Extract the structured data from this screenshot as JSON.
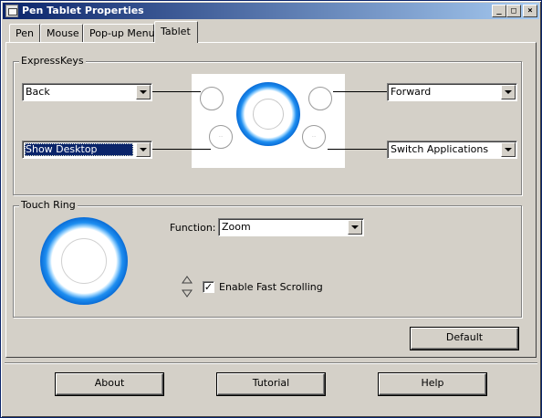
{
  "window": {
    "title": "Pen Tablet Properties",
    "controls": {
      "minimize": "_",
      "maximize": "□",
      "close": "×"
    }
  },
  "tabs": [
    {
      "label": "Pen",
      "active": false
    },
    {
      "label": "Mouse",
      "active": false
    },
    {
      "label": "Pop-up Menu",
      "active": false
    },
    {
      "label": "Tablet",
      "active": true
    }
  ],
  "expresskeys": {
    "label": "ExpressKeys",
    "top_left": {
      "value": "Back"
    },
    "bottom_left": {
      "value": "Show Desktop",
      "selected": true
    },
    "top_right": {
      "value": "Forward"
    },
    "bottom_right": {
      "value": "Switch Applications"
    },
    "key_labels": {
      "bottom_left": "···",
      "bottom_right": "···"
    }
  },
  "touch_ring": {
    "label": "Touch Ring",
    "function_label": "Function:",
    "function_value": "Zoom",
    "fast_scrolling_label": "Enable Fast Scrolling",
    "fast_scrolling_checked": true,
    "check_mark": "✓"
  },
  "buttons": {
    "default": "Default",
    "about": "About",
    "tutorial": "Tutorial",
    "help": "Help"
  },
  "colors": {
    "title_start": "#0a246a",
    "title_end": "#a6caf0",
    "ring_blue": "#1e8ef0",
    "face": "#d4d0c8"
  }
}
